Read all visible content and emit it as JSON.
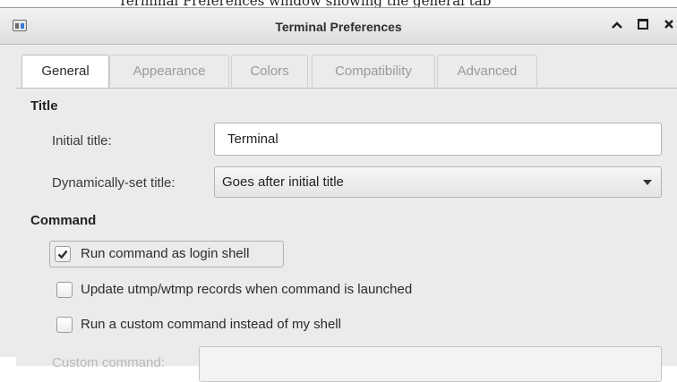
{
  "caption": "Terminal Preferences window showing the general tab",
  "window": {
    "title": "Terminal Preferences",
    "controls": {
      "minimize": "^",
      "maximize": "□",
      "close": "✕"
    }
  },
  "tabs": [
    {
      "label": "General",
      "active": true
    },
    {
      "label": "Appearance",
      "active": false
    },
    {
      "label": "Colors",
      "active": false
    },
    {
      "label": "Compatibility",
      "active": false
    },
    {
      "label": "Advanced",
      "active": false
    }
  ],
  "title_section": {
    "heading": "Title",
    "initial_title_label": "Initial title:",
    "initial_title_value": "Terminal",
    "dynamic_title_label": "Dynamically-set title:",
    "dynamic_title_value": "Goes after initial title"
  },
  "command_section": {
    "heading": "Command",
    "login_shell": {
      "label": "Run command as login shell",
      "checked": true
    },
    "update_utmp": {
      "label": "Update utmp/wtmp records when command is launched",
      "checked": false
    },
    "custom_command": {
      "label": "Run a custom command instead of my shell",
      "checked": false
    },
    "custom_command_field_label": "Custom command:",
    "custom_command_value": ""
  },
  "colors": {
    "titlebar": "#e6e6e6",
    "panel": "#ebebeb",
    "disabled_text": "#b9b9b9"
  }
}
